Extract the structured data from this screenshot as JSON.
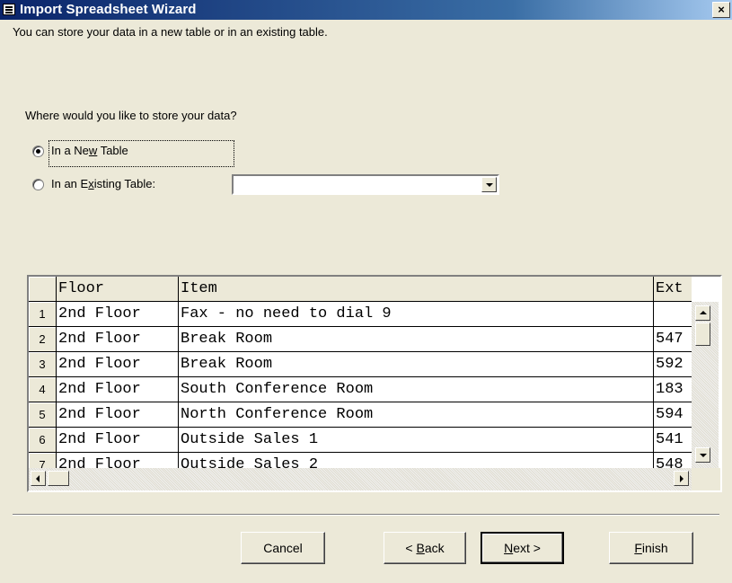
{
  "window": {
    "title": "Import Spreadsheet Wizard",
    "close_glyph": "×"
  },
  "intro_text": "You can store your data in a new table or in an existing table.",
  "question_text": "Where would you like to store your data?",
  "options": {
    "new_table": {
      "before": "In a Ne",
      "mnemonic": "w",
      "after": " Table",
      "checked": true
    },
    "existing_table": {
      "before": "In an E",
      "mnemonic": "x",
      "after": "isting Table:",
      "checked": false
    }
  },
  "existing_table_combo": {
    "value": ""
  },
  "grid": {
    "columns": [
      "Floor",
      "Item",
      "Ext"
    ],
    "rows": [
      {
        "num": "1",
        "cells": [
          "2nd Floor",
          "Fax - no need to dial 9",
          ""
        ]
      },
      {
        "num": "2",
        "cells": [
          "2nd Floor",
          "Break Room",
          "547"
        ]
      },
      {
        "num": "3",
        "cells": [
          "2nd Floor",
          "Break Room",
          "592"
        ]
      },
      {
        "num": "4",
        "cells": [
          "2nd Floor",
          "South Conference Room",
          "183"
        ]
      },
      {
        "num": "5",
        "cells": [
          "2nd Floor",
          "North Conference Room",
          "594"
        ]
      },
      {
        "num": "6",
        "cells": [
          "2nd Floor",
          "Outside Sales 1",
          "541"
        ]
      },
      {
        "num": "7",
        "cells": [
          "2nd Floor",
          "Outside Sales 2",
          "548"
        ]
      }
    ]
  },
  "buttons": {
    "cancel": {
      "label": "Cancel"
    },
    "back": {
      "before": "< ",
      "mnemonic": "B",
      "after": "ack"
    },
    "next": {
      "before": "",
      "mnemonic": "N",
      "after": "ext >"
    },
    "finish": {
      "before": "",
      "mnemonic": "F",
      "after": "inish"
    }
  },
  "icons": {
    "title_icon": "table-icon",
    "scroll_up": "arrow-up-icon",
    "scroll_down": "arrow-down-icon",
    "scroll_left": "arrow-left-icon",
    "scroll_right": "arrow-right-icon",
    "combo_dropdown": "chevron-down-icon"
  },
  "colors": {
    "titlebar_start": "#0a246a",
    "titlebar_end": "#a6caf0",
    "dialog_bg": "#ece9d8"
  }
}
